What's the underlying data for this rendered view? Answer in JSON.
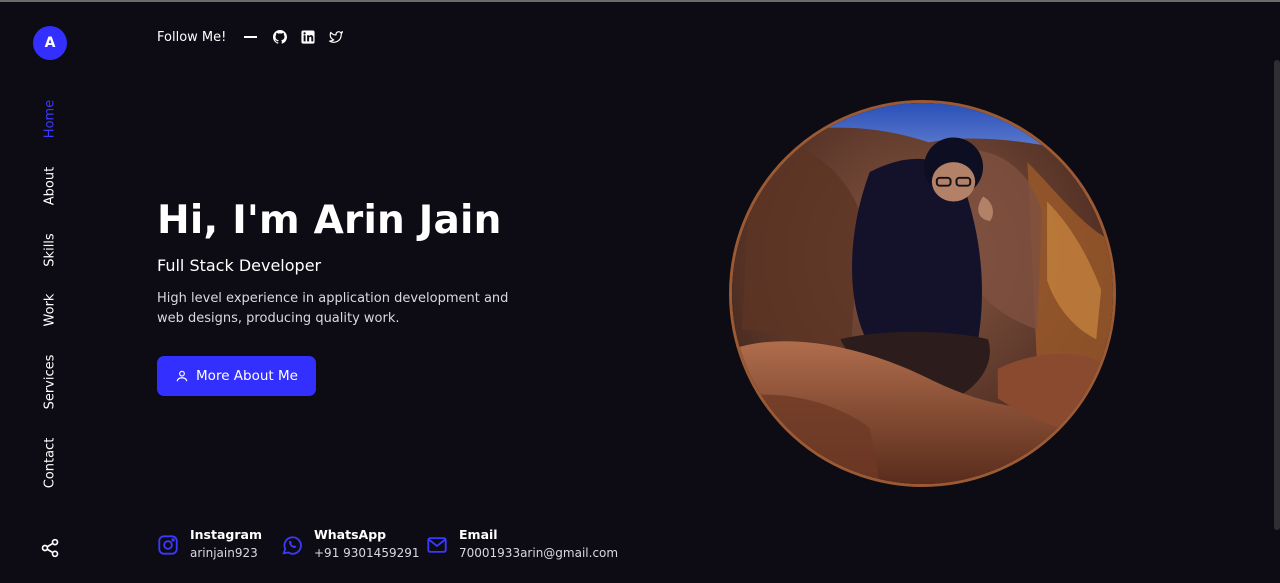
{
  "colors": {
    "accent": "#3330ff",
    "background": "#0d0b13",
    "photo_border": "#9b5a34"
  },
  "logo": {
    "letter": "A"
  },
  "nav": {
    "items": [
      {
        "label": "Home",
        "active": true
      },
      {
        "label": "About",
        "active": false
      },
      {
        "label": "Skills",
        "active": false
      },
      {
        "label": "Work",
        "active": false
      },
      {
        "label": "Services",
        "active": false
      },
      {
        "label": "Contact",
        "active": false
      }
    ],
    "share_icon": "share-icon"
  },
  "follow": {
    "label": "Follow Me!",
    "icons": [
      "github-icon",
      "linkedin-icon",
      "twitter-icon"
    ]
  },
  "hero": {
    "title": "Hi, I'm Arin Jain",
    "subtitle": "Full Stack Developer",
    "description": "High level experience in application development and web designs, producing quality work.",
    "button_label": "More About Me",
    "button_icon": "user-icon",
    "photo": "profile-photo"
  },
  "contacts": [
    {
      "title": "Instagram",
      "value": "arinjain923",
      "icon": "instagram-icon"
    },
    {
      "title": "WhatsApp",
      "value": "+91 9301459291",
      "icon": "whatsapp-icon"
    },
    {
      "title": "Email",
      "value": "70001933arin@gmail.com",
      "icon": "mail-icon"
    }
  ]
}
